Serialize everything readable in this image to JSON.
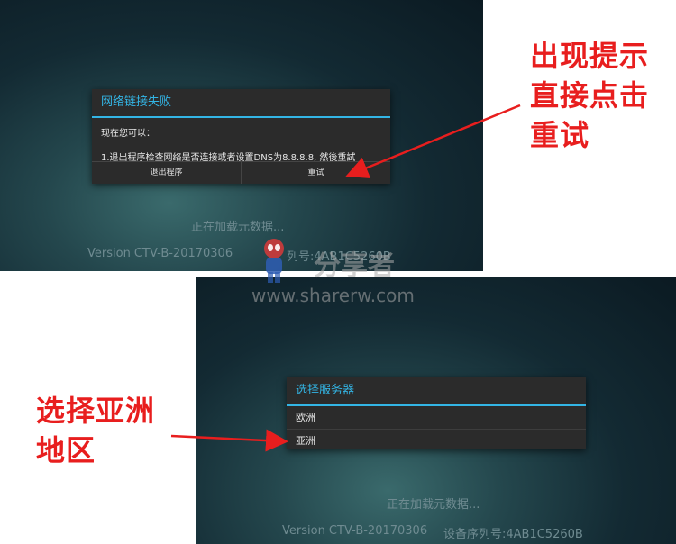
{
  "top_screen": {
    "dialog": {
      "title": "网络链接失败",
      "line1": "现在您可以：",
      "line2": "1.退出程序检查网络是否连接或者设置DNS为8.8.8.8, 然後重試",
      "button_exit": "退出程序",
      "button_retry": "重试"
    },
    "loading_text": "正在加载元数据...",
    "version_text": "Version CTV-B-20170306",
    "serial_partial": "列号:4AB1C5260B"
  },
  "bottom_screen": {
    "dialog": {
      "title": "选择服务器",
      "items": [
        "欧洲",
        "亚洲"
      ]
    },
    "loading_text": "正在加载元数据...",
    "version_text": "Version CTV-B-20170306",
    "serial_text": "设备序列号:4AB1C5260B"
  },
  "annotations": {
    "retry_note": [
      "出现提示",
      "直接点击",
      "重试"
    ],
    "server_note": [
      "选择亚洲",
      "地区"
    ]
  },
  "watermark": {
    "brand": "分享者",
    "url": "www.sharerw.com"
  },
  "colors": {
    "accent": "#33b5e5",
    "annotation_red": "#e81e1e",
    "dialog_bg": "#2b2b2b"
  }
}
